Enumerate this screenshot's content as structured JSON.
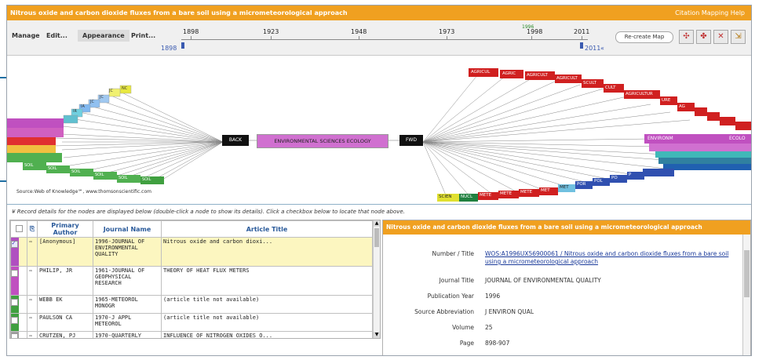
{
  "window": {
    "title": "Nitrous oxide and carbon dioxide fluxes from a bare soil using a micrometeorological approach",
    "help_link": "Citation Mapping Help"
  },
  "toolbar": {
    "menus": [
      "Manage",
      "Edit...",
      "Appearance",
      "Print..."
    ],
    "timeline": {
      "ticks": [
        "1898",
        "1923",
        "1948",
        "1973",
        "1998",
        "2011"
      ],
      "marker_label": "1996",
      "range_start": "1898",
      "range_end": "2011",
      "range_end_suffix": "«"
    },
    "recreate_button": "Re-create Map",
    "tool_icons": [
      "expand-nodes-icon",
      "collapse-nodes-icon",
      "fit-map-icon",
      "export-icon"
    ]
  },
  "map": {
    "center_node": "ENVIRONMENTAL SCIENCES ECOLOGY",
    "back_label": "BACK",
    "fwd_label": "FWD",
    "left_nodes": [
      "JC",
      "NC",
      "JC",
      "IA",
      "IR",
      "JC"
    ],
    "right_top_nodes": [
      "AGRICUL",
      "AGRIC",
      "AGRICULT",
      "AGRICULT",
      "SCULT",
      "CULT",
      "AGRICULTUR",
      "URE",
      "AG"
    ],
    "right_mid_nodes": [
      "ENVIRONM",
      "ECOLO"
    ],
    "right_bottom_nodes": [
      "SCIEN",
      "NUCL",
      "METE",
      "METE",
      "METE",
      "MET",
      "MET",
      "POR",
      "POL",
      "PO",
      "P"
    ],
    "left_bottom_nodes": [
      "SOIL",
      "SOIL",
      "SOIL",
      "SOIL",
      "SOIL",
      "SOIL"
    ],
    "source": "Source:Web of Knowledge℠, www.thomsonscientific.com"
  },
  "notice": "Record details for the nodes are displayed below (double-click a node to show its details). Click a checkbox below to locate that node above.",
  "grid": {
    "headers": [
      "Primary Author",
      "Journal Name",
      "Article Title"
    ],
    "rows": [
      {
        "author": "[Anonymous]",
        "journal": "1996-JOURNAL OF ENVIRONMENTAL QUALITY",
        "title": "Nitrous oxide and carbon dioxi...",
        "checked": true,
        "color": "#b050c0"
      },
      {
        "author": "PHILIP, JR",
        "journal": "1961-JOURNAL OF GEOPHYSICAL RESEARCH",
        "title": "THEORY OF HEAT FLUX METERS",
        "checked": false,
        "color": "#c050c0"
      },
      {
        "author": "WEBB EK",
        "journal": "1965-METEOROL MONOGR",
        "title": "(article title not available)",
        "checked": false,
        "color": "#40a040"
      },
      {
        "author": "PAULSON CA",
        "journal": "1970-J APPL METEOROL",
        "title": "(article title not available)",
        "checked": false,
        "color": "#40a040"
      },
      {
        "author": "CRUTZEN, PJ",
        "journal": "1970-QUARTERLY",
        "title": "INFLUENCE OF NITROGEN OXIDES O...",
        "checked": false,
        "color": "#a0a0a0"
      }
    ]
  },
  "detail": {
    "header": "Nitrous oxide and carbon dioxide fluxes from a bare soil using a micrometeorological approach",
    "fields": [
      {
        "label": "Number / Title",
        "value": "WOS:A1996UX56900061 / Nitrous oxide and carbon dioxide fluxes from a bare soil using a micrometeorological approach",
        "link": true
      },
      {
        "label": "Journal Title",
        "value": "JOURNAL OF ENVIRONMENTAL QUALITY",
        "link": false
      },
      {
        "label": "Publication Year",
        "value": "1996",
        "link": false
      },
      {
        "label": "Source Abbreviation",
        "value": "J ENVIRON QUAL",
        "link": false
      },
      {
        "label": "Volume",
        "value": "25",
        "link": false
      },
      {
        "label": "Page",
        "value": "898-907",
        "link": false
      }
    ]
  }
}
